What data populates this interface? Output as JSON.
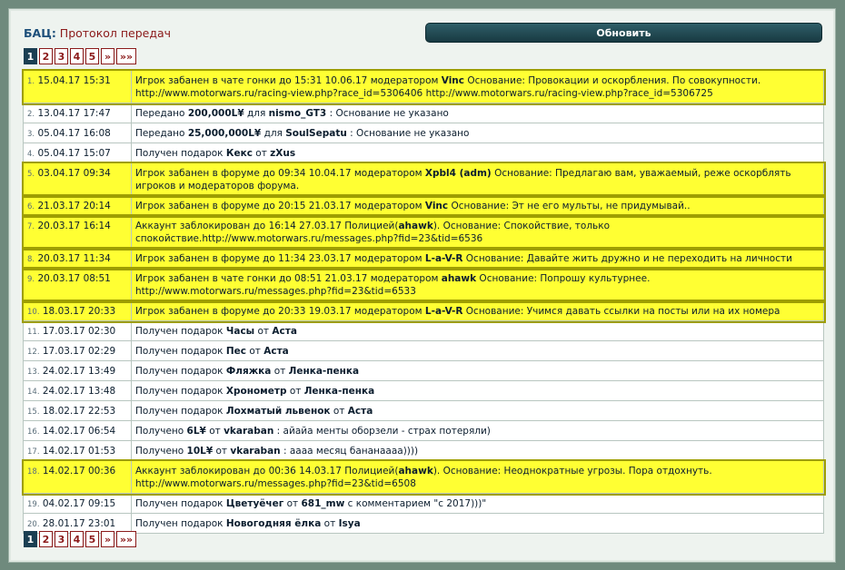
{
  "header": {
    "bac": "БАЦ",
    "colon": ":",
    "title": "Протокол передач",
    "refresh_label": "Обновить"
  },
  "pager": {
    "pages": [
      "1",
      "2",
      "3",
      "4",
      "5"
    ],
    "next": "»",
    "last": "»»"
  },
  "rows": [
    {
      "n": "1.",
      "date": "15.04.17 15:31",
      "hl": true,
      "parts": [
        [
          "Игрок забанен в чате гонки до 15:31 10.06.17 модератором ",
          ""
        ],
        [
          "Vinc",
          "b"
        ],
        [
          " Основание: Провокации и оскорбления. По совокупности. http://www.motorwars.ru/racing-view.php?race_id=5306406 http://www.motorwars.ru/racing-view.php?race_id=5306725",
          ""
        ]
      ]
    },
    {
      "n": "2.",
      "date": "13.04.17 17:47",
      "hl": false,
      "parts": [
        [
          "Передано ",
          ""
        ],
        [
          "200,000L¥",
          "b"
        ],
        [
          " для ",
          ""
        ],
        [
          "nismo_GT3",
          "b"
        ],
        [
          " : Основание не указано",
          ""
        ]
      ]
    },
    {
      "n": "3.",
      "date": "05.04.17 16:08",
      "hl": false,
      "parts": [
        [
          "Передано ",
          ""
        ],
        [
          "25,000,000L¥",
          "b"
        ],
        [
          " для ",
          ""
        ],
        [
          "SoulSepatu",
          "b"
        ],
        [
          " : Основание не указано",
          ""
        ]
      ]
    },
    {
      "n": "4.",
      "date": "05.04.17 15:07",
      "hl": false,
      "parts": [
        [
          "Получен подарок ",
          ""
        ],
        [
          "Кекс",
          "b"
        ],
        [
          " от ",
          ""
        ],
        [
          "zXus",
          "b"
        ]
      ]
    },
    {
      "n": "5.",
      "date": "03.04.17 09:34",
      "hl": true,
      "parts": [
        [
          "Игрок забанен в форуме до 09:34 10.04.17 модератором ",
          ""
        ],
        [
          "Xpbl4 (adm)",
          "b"
        ],
        [
          " Основание: Предлагаю вам, уважаемый, реже оскорблять игроков и модераторов форума.",
          ""
        ]
      ]
    },
    {
      "n": "6.",
      "date": "21.03.17 20:14",
      "hl": true,
      "parts": [
        [
          "Игрок забанен в форуме до 20:15 21.03.17 модератором ",
          ""
        ],
        [
          "Vinc",
          "b"
        ],
        [
          " Основание: Эт не его мульты, не придумывай..",
          ""
        ]
      ]
    },
    {
      "n": "7.",
      "date": "20.03.17 16:14",
      "hl": true,
      "parts": [
        [
          "Аккаунт заблокирован до 16:14 27.03.17 Полицией(",
          ""
        ],
        [
          "ahawk",
          "b"
        ],
        [
          "). Основание: Спокойствие, только спокойствие.http://www.motorwars.ru/messages.php?fid=23&tid=6536",
          ""
        ]
      ]
    },
    {
      "n": "8.",
      "date": "20.03.17 11:34",
      "hl": true,
      "parts": [
        [
          "Игрок забанен в форуме до 11:34 23.03.17 модератором ",
          ""
        ],
        [
          "L-a-V-R",
          "b"
        ],
        [
          " Основание: Давайте жить дружно и не переходить на личности",
          ""
        ]
      ]
    },
    {
      "n": "9.",
      "date": "20.03.17 08:51",
      "hl": true,
      "parts": [
        [
          "Игрок забанен в чате гонки до 08:51 21.03.17 модератором ",
          ""
        ],
        [
          "ahawk",
          "b"
        ],
        [
          " Основание: Попрошу культурнее. http://www.motorwars.ru/messages.php?fid=23&tid=6533",
          ""
        ]
      ]
    },
    {
      "n": "10.",
      "date": "18.03.17 20:33",
      "hl": true,
      "parts": [
        [
          "Игрок забанен в форуме до 20:33 19.03.17 модератором ",
          ""
        ],
        [
          "L-a-V-R",
          "b"
        ],
        [
          " Основание: Учимся давать ссылки на посты или на их номера",
          ""
        ]
      ]
    },
    {
      "n": "11.",
      "date": "17.03.17 02:30",
      "hl": false,
      "parts": [
        [
          "Получен подарок ",
          ""
        ],
        [
          "Часы",
          "b"
        ],
        [
          " от ",
          ""
        ],
        [
          "Аста",
          "b"
        ]
      ]
    },
    {
      "n": "12.",
      "date": "17.03.17 02:29",
      "hl": false,
      "parts": [
        [
          "Получен подарок ",
          ""
        ],
        [
          "Пес",
          "b"
        ],
        [
          " от ",
          ""
        ],
        [
          "Аста",
          "b"
        ]
      ]
    },
    {
      "n": "13.",
      "date": "24.02.17 13:49",
      "hl": false,
      "parts": [
        [
          "Получен подарок ",
          ""
        ],
        [
          "Фляжка",
          "b"
        ],
        [
          " от ",
          ""
        ],
        [
          "Ленка-пенка",
          "b"
        ]
      ]
    },
    {
      "n": "14.",
      "date": "24.02.17 13:48",
      "hl": false,
      "parts": [
        [
          "Получен подарок ",
          ""
        ],
        [
          "Хронометр",
          "b"
        ],
        [
          " от ",
          ""
        ],
        [
          "Ленка-пенка",
          "b"
        ]
      ]
    },
    {
      "n": "15.",
      "date": "18.02.17 22:53",
      "hl": false,
      "parts": [
        [
          "Получен подарок ",
          ""
        ],
        [
          "Лохматый львенок",
          "b"
        ],
        [
          " от ",
          ""
        ],
        [
          "Аста",
          "b"
        ]
      ]
    },
    {
      "n": "16.",
      "date": "14.02.17 06:54",
      "hl": false,
      "parts": [
        [
          "Получено ",
          ""
        ],
        [
          "6L¥",
          "b"
        ],
        [
          " от ",
          ""
        ],
        [
          "vkaraban",
          "b"
        ],
        [
          " : айайа менты оборзели - страх потеряли)",
          ""
        ]
      ]
    },
    {
      "n": "17.",
      "date": "14.02.17 01:53",
      "hl": false,
      "parts": [
        [
          "Получено ",
          ""
        ],
        [
          "10L¥",
          "b"
        ],
        [
          " от ",
          ""
        ],
        [
          "vkaraban",
          "b"
        ],
        [
          " : аааа месяц бананаааа))))",
          ""
        ]
      ]
    },
    {
      "n": "18.",
      "date": "14.02.17 00:36",
      "hl": true,
      "parts": [
        [
          "Аккаунт заблокирован до 00:36 14.03.17 Полицией(",
          ""
        ],
        [
          "ahawk",
          "b"
        ],
        [
          "). Основание: Неоднократные угрозы. Пора отдохнуть. http://www.motorwars.ru/messages.php?fid=23&tid=6508",
          ""
        ]
      ]
    },
    {
      "n": "19.",
      "date": "04.02.17 09:15",
      "hl": false,
      "parts": [
        [
          "Получен подарок ",
          ""
        ],
        [
          "Цветуёчег",
          "b"
        ],
        [
          " от ",
          ""
        ],
        [
          "681_mw",
          "b"
        ],
        [
          " с комментарием \"с 2017)))\"",
          ""
        ]
      ]
    },
    {
      "n": "20.",
      "date": "28.01.17 23:01",
      "hl": false,
      "parts": [
        [
          "Получен подарок ",
          ""
        ],
        [
          "Новогодняя ёлка",
          "b"
        ],
        [
          " от ",
          ""
        ],
        [
          "Isya",
          "b"
        ]
      ]
    }
  ]
}
